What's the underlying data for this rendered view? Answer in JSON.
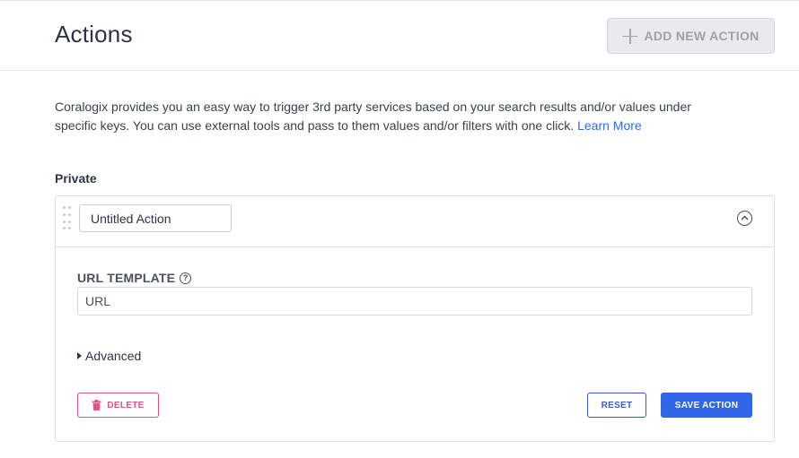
{
  "header": {
    "title": "Actions",
    "add_button_label": "ADD NEW ACTION"
  },
  "description": {
    "text": "Coralogix provides you an easy way to trigger 3rd party services based on your search results and/or values under specific keys. You can use external tools and pass to them values and/or filters with one click.",
    "link_label": "Learn More"
  },
  "section": {
    "label": "Private"
  },
  "action_card": {
    "name_value": "Untitled Action",
    "url_template_label": "URL TEMPLATE",
    "url_placeholder": "URL",
    "advanced_label": "Advanced",
    "delete_label": "DELETE",
    "reset_label": "RESET",
    "save_label": "SAVE ACTION"
  },
  "colors": {
    "primary": "#2f67e8",
    "danger": "#e05683",
    "disabled_bg": "#e8eaee"
  },
  "icons": [
    "plus-icon",
    "drag-handle-icon",
    "chevron-up-circle-icon",
    "help-circle-icon",
    "caret-right-icon",
    "trash-icon"
  ]
}
